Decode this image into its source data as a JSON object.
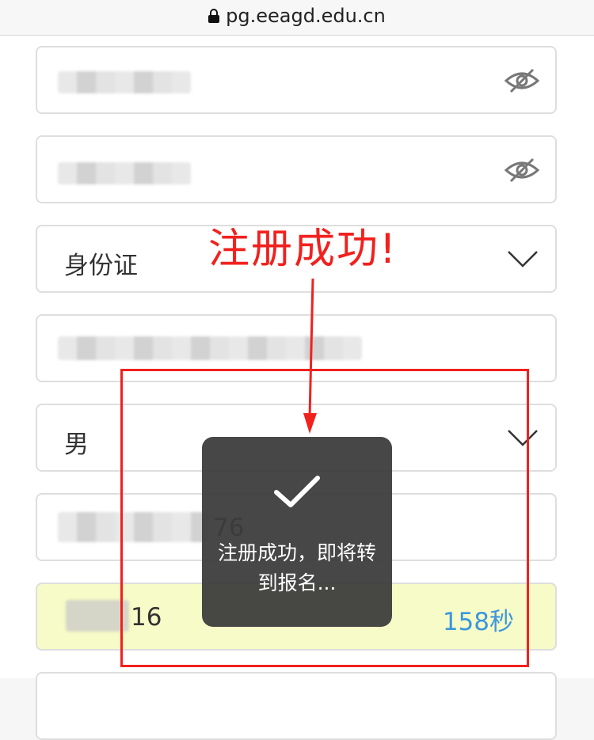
{
  "browser": {
    "url": "pg.eeagd.edu.cn"
  },
  "form": {
    "id_type": "身份证",
    "gender": "男",
    "phone_visible_suffix": "76",
    "code_visible_suffix": "16",
    "countdown": "158秒"
  },
  "annotation": {
    "title": "注册成功!"
  },
  "toast": {
    "message": "注册成功，即将转到报名..."
  },
  "colors": {
    "annotation_red": "#f1211e",
    "countdown_blue": "#3b97df",
    "highlight_field": "#f7fbc7"
  }
}
